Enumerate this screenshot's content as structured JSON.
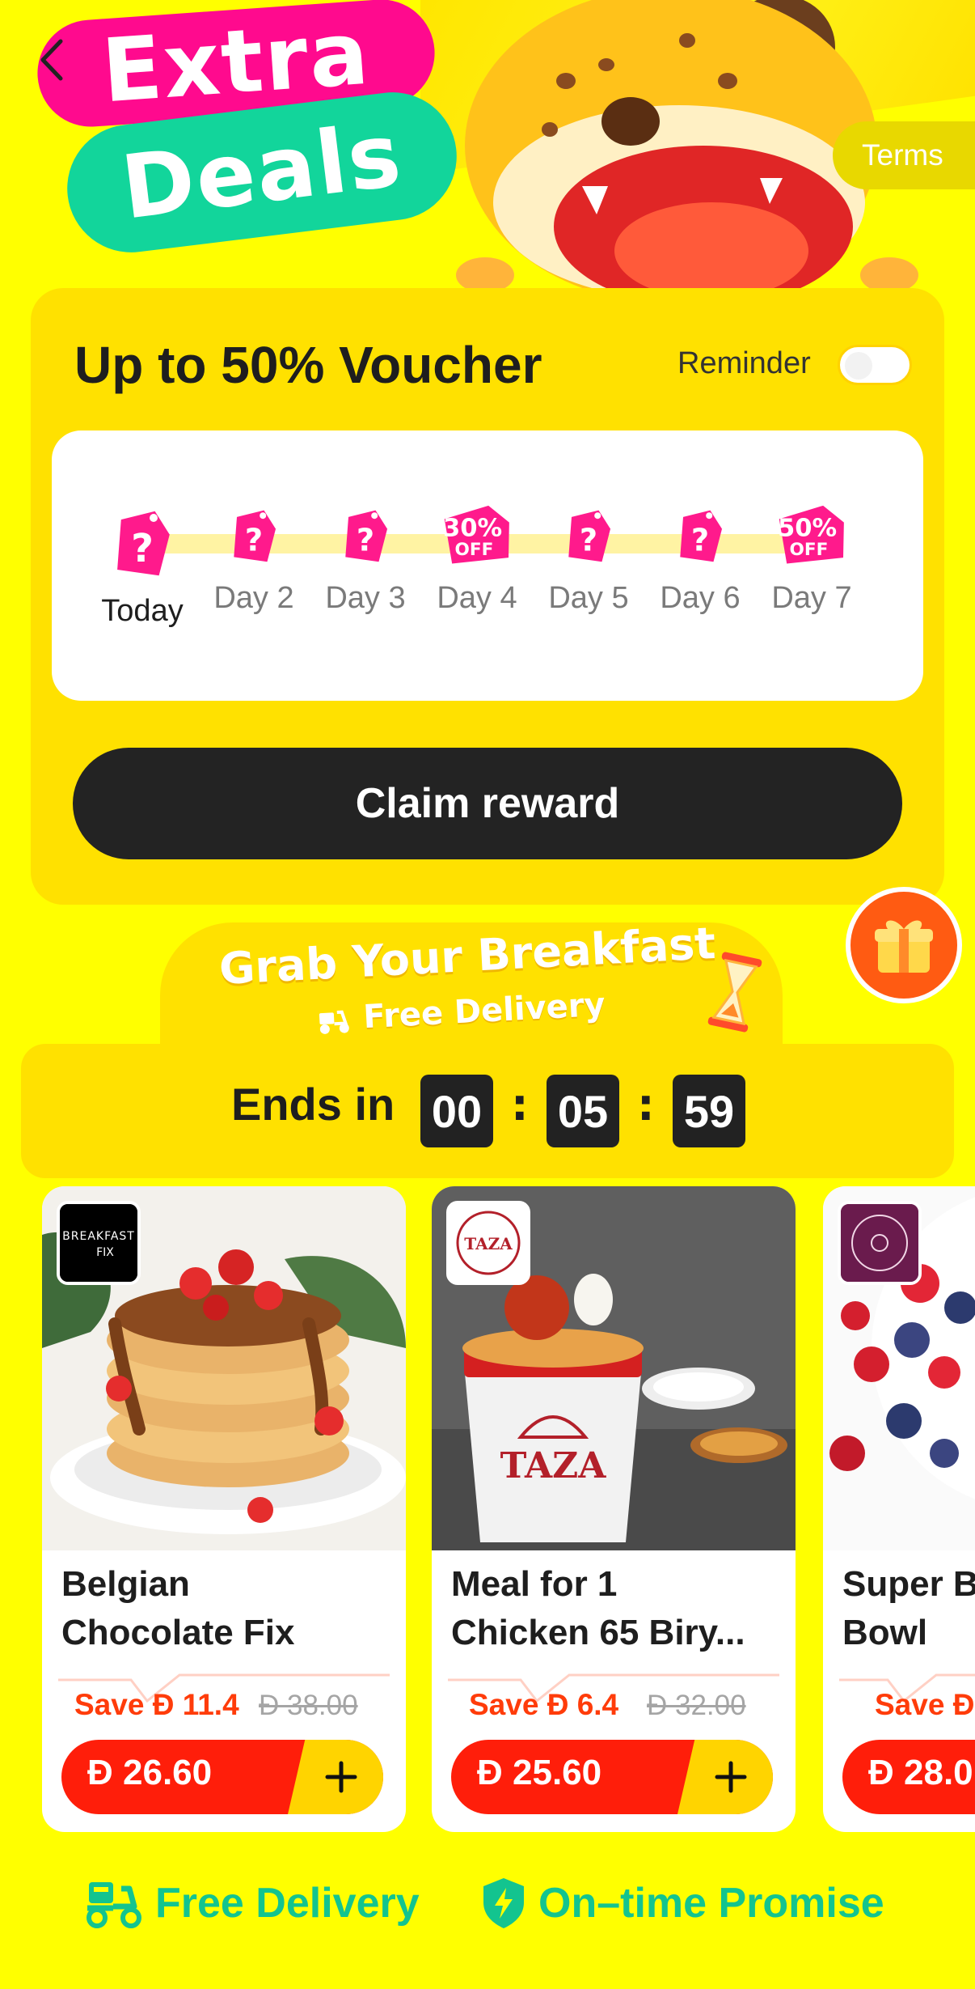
{
  "header": {
    "title_line1": "Extra",
    "title_line2": "Deals",
    "terms_label": "Terms"
  },
  "voucher": {
    "title": "Up to 50% Voucher",
    "reminder_label": "Reminder",
    "reminder_on": false,
    "days": [
      {
        "label": "Today",
        "reward": "?"
      },
      {
        "label": "Day 2",
        "reward": "?"
      },
      {
        "label": "Day 3",
        "reward": "?"
      },
      {
        "label": "Day 4",
        "reward": "30% OFF"
      },
      {
        "label": "Day 5",
        "reward": "?"
      },
      {
        "label": "Day 6",
        "reward": "?"
      },
      {
        "label": "Day 7",
        "reward": "50% OFF"
      }
    ],
    "claim_label": "Claim reward"
  },
  "breakfast": {
    "title": "Grab Your Breakfast",
    "subtitle": "Free Delivery"
  },
  "countdown": {
    "label": "Ends in",
    "hours": "00",
    "minutes": "05",
    "seconds": "59",
    "separator": ":"
  },
  "products": [
    {
      "name_line1": "Belgian",
      "name_line2": "Chocolate Fix",
      "save": "Save Đ 11.4",
      "old_price": "Đ 38.00",
      "price": "Đ 26.60"
    },
    {
      "name_line1": "Meal for 1",
      "name_line2": "Chicken 65 Biry...",
      "save": "Save Đ 6.4",
      "old_price": "Đ 32.00",
      "price": "Đ 25.60"
    },
    {
      "name_line1": "Super B",
      "name_line2": "Bowl",
      "save": "Save Đ",
      "old_price": "",
      "price": "Đ 28.0"
    }
  ],
  "logos": {
    "breakfast_fix": "BREAKFAST FIX",
    "taza": "TAZA"
  },
  "footer": {
    "free_delivery": "Free Delivery",
    "ontime": "On–time Promise"
  },
  "colors": {
    "background": "#FFFF00",
    "card": "#FFE100",
    "pink": "#FF0A8E",
    "green": "#12D59B",
    "red": "#FF1E0A",
    "dark": "#232323"
  }
}
